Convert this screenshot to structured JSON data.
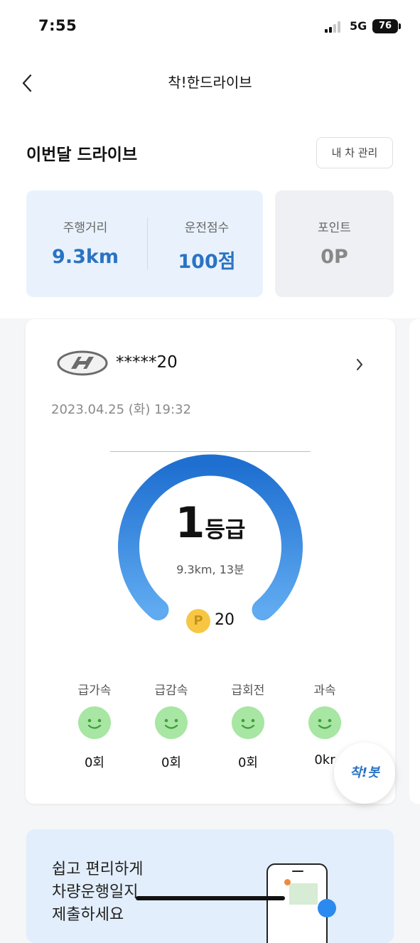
{
  "status_bar": {
    "time": "7:55",
    "network": "5G",
    "battery": "76"
  },
  "nav": {
    "title": "착!한드라이브"
  },
  "section": {
    "title": "이번달 드라이브",
    "manage_button": "내 차 관리"
  },
  "summary": {
    "distance_label": "주행거리",
    "distance_value": "9.3km",
    "score_label": "운전점수",
    "score_value": "100점",
    "points_label": "포인트",
    "points_value": "0P"
  },
  "drive": {
    "plate": "*****20",
    "date": "2023.04.25 (화) 19:32",
    "grade_number": "1",
    "grade_unit": "등급",
    "distance_time": "9.3km, 13분",
    "coin_letter": "P",
    "reward_points": "20",
    "events": [
      {
        "label": "급가속",
        "count": "0회"
      },
      {
        "label": "급감속",
        "count": "0회"
      },
      {
        "label": "급회전",
        "count": "0회"
      },
      {
        "label": "과속",
        "count": "0kr"
      }
    ]
  },
  "fab": {
    "label": "착!봇"
  },
  "banner": {
    "lines": [
      "쉽고 편리하게",
      "차량운행일지",
      "제출하세요"
    ]
  },
  "colors": {
    "accent": "#2a73c3",
    "gauge_start": "#1f6fd1",
    "gauge_end": "#5faaf0",
    "face": "#a8e6a3"
  }
}
